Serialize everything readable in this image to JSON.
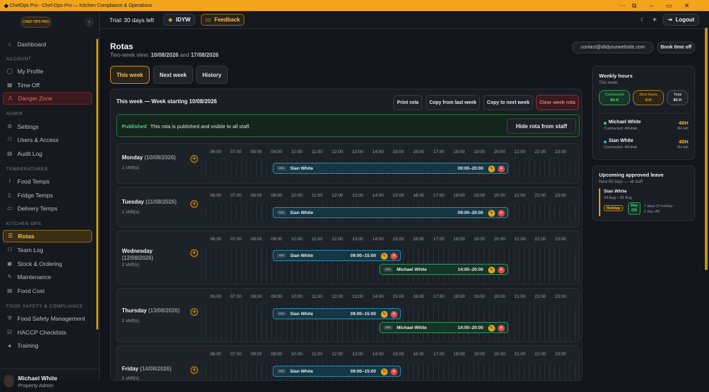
{
  "window": {
    "title": "ChefOpx Pro - Chef-Ops-Pro — Kitchen Compliance & Operations"
  },
  "sidebar": {
    "logo_text": "CHEF OPS PRO",
    "dashboard": "Dashboard",
    "sections": {
      "account": "ACCOUNT",
      "admin": "ADMIN",
      "temperatures": "TEMPERATURES",
      "kitchen_ops": "KITCHEN OPS",
      "food_safety": "FOOD SAFETY & COMPLIANCE"
    },
    "account": [
      "My Profile",
      "Time Off",
      "Danger Zone"
    ],
    "admin": [
      "Settings",
      "Users & Access",
      "Audit Log"
    ],
    "temperatures": [
      "Food Temps",
      "Fridge Temps",
      "Delivery Temps"
    ],
    "kitchen_ops": [
      "Rotas",
      "Team Log",
      "Stock & Ordering",
      "Maintenance",
      "Food Cost"
    ],
    "food_safety": [
      "Food Safety Management",
      "HACCP Checklists",
      "Training"
    ],
    "user": {
      "name": "Michael White",
      "role": "Property Admin"
    }
  },
  "topbar": {
    "trial": "Trial: 30 days left",
    "org": "IDYW",
    "feedback": "Feedback",
    "logout": "Logout"
  },
  "header": {
    "title": "Rotas",
    "subtitle_prefix": "Two-week view:",
    "date1": "10/08/2026",
    "and": "and",
    "date2": "17/08/2026",
    "contact": "contact@ididyourwebsite.com",
    "book_time_off": "Book time off"
  },
  "tabs": [
    "This week",
    "Next week",
    "History"
  ],
  "panel": {
    "title": "This week — Week starting 10/08/2026",
    "actions": [
      "Print rota",
      "Copy from last week",
      "Copy to next week",
      "Clear week rota"
    ],
    "banner": {
      "status": "Published",
      "text": "This rota is published and visible to all staff.",
      "button": "Hide rota from staff"
    }
  },
  "hours": [
    "06:00",
    "07:00",
    "08:00",
    "09:00",
    "10:00",
    "11:00",
    "12:00",
    "13:00",
    "14:00",
    "15:00",
    "16:00",
    "17:00",
    "18:00",
    "19:00",
    "20:00",
    "21:00",
    "22:00",
    "23:00"
  ],
  "days": [
    {
      "day": "Monday",
      "date": "(10/08/2026)",
      "count": "1 shift(s)",
      "shifts": [
        {
          "name": "Sian White",
          "time": "09:00–20:00",
          "tag": "KPA"
        }
      ]
    },
    {
      "day": "Tuesday",
      "date": "(11/08/2026)",
      "count": "1 shift(s)",
      "shifts": [
        {
          "name": "Sian White",
          "time": "09:00–20:00",
          "tag": "KPA"
        }
      ]
    },
    {
      "day": "Wednesday",
      "date": "(12/08/2026)",
      "count": "2 shift(s)",
      "shifts": [
        {
          "name": "Sian White",
          "time": "09:00–15:00",
          "tag": "KPA"
        },
        {
          "name": "Michael White",
          "time": "14:00–20:00",
          "tag": "KPA"
        }
      ]
    },
    {
      "day": "Thursday",
      "date": "(13/08/2026)",
      "count": "2 shift(s)",
      "shifts": [
        {
          "name": "Sian White",
          "time": "09:00–15:00",
          "tag": "KPA"
        },
        {
          "name": "Michael White",
          "time": "14:00–20:00",
          "tag": "KPA"
        }
      ]
    },
    {
      "day": "Friday",
      "date": "(14/08/2026)",
      "count": "2 shift(s)",
      "shifts": [
        {
          "name": "Sian White",
          "time": "09:00–15:00",
          "tag": "KPA"
        }
      ]
    }
  ],
  "weekly_hours": {
    "title": "Weekly hours",
    "subtitle": "This week",
    "contracted_label": "Contracted",
    "contracted_value": "80-H",
    "zero_label": "Zero hours",
    "zero_value": "0-H",
    "total_label": "Total",
    "total_value": "80-H",
    "staff": [
      {
        "name": "Michael White",
        "contracted": "Contracted: 40H/wk",
        "hours": "40H",
        "left": "0H left",
        "color": "#3fcf6a"
      },
      {
        "name": "Sian White",
        "contracted": "Contracted: 40H/wk",
        "hours": "40H",
        "left": "0H left",
        "color": "#2fb6e0"
      }
    ]
  },
  "leave": {
    "title": "Upcoming approved leave",
    "subtitle": "Next 60 days — all staff",
    "name": "Sian White",
    "dates": "24 Aug – 30 Aug",
    "holiday": "Holiday",
    "day_off_1": "Day",
    "day_off_2": "Off",
    "summary_1": "7 days (5 holiday ·",
    "summary_2": "2 day off)"
  }
}
